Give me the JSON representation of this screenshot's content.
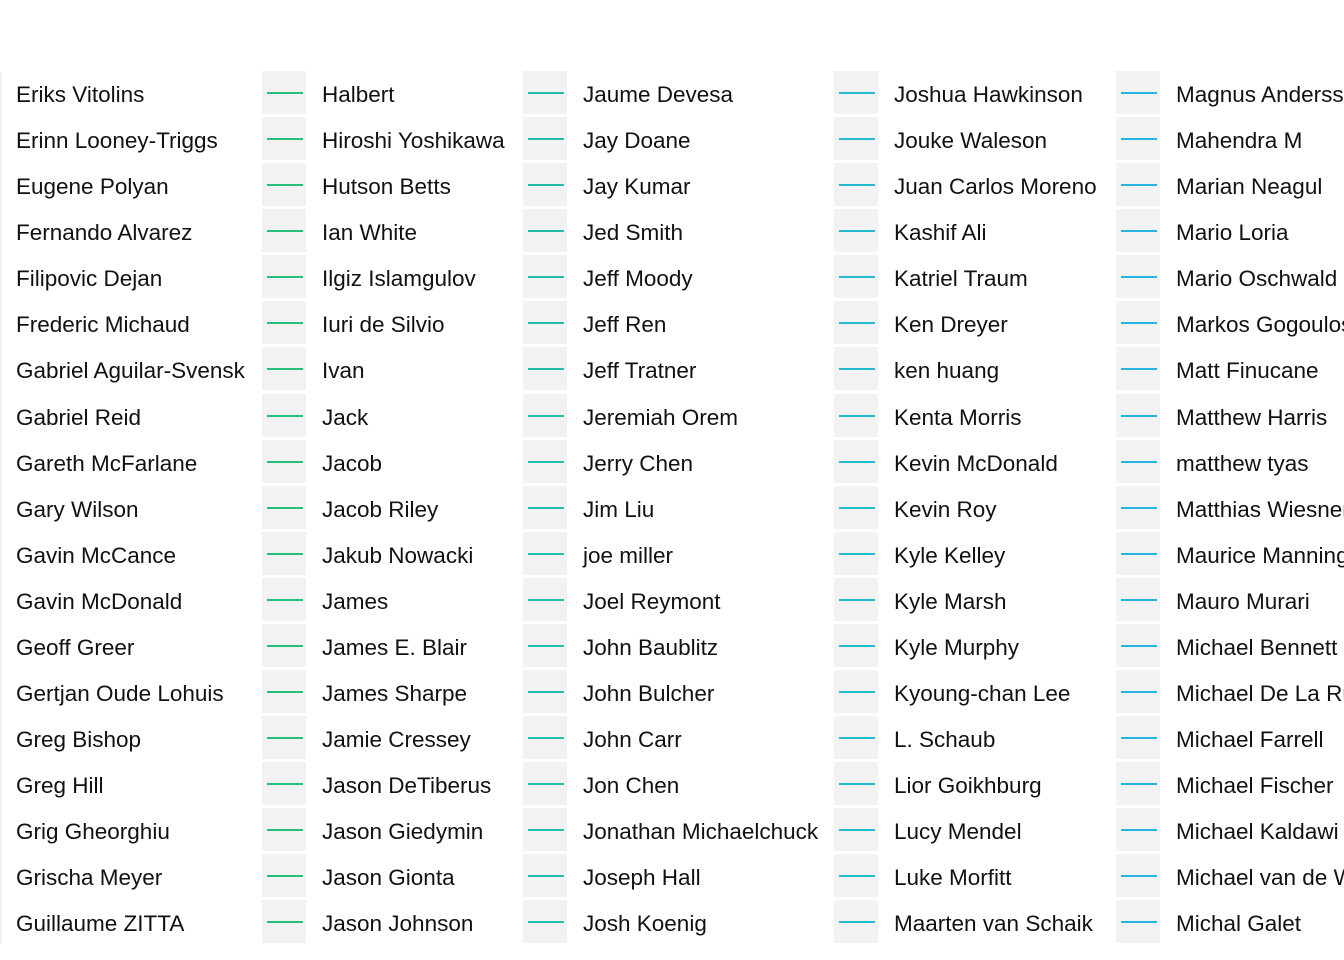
{
  "columns": [
    {
      "names": [
        "Eriks Vitolins",
        "Erinn Looney-Triggs",
        "Eugene Polyan",
        "Fernando Alvarez",
        "Filipovic Dejan",
        "Frederic Michaud",
        "Gabriel Aguilar-Svensk",
        "Gabriel Reid",
        "Gareth McFarlane",
        "Gary Wilson",
        "Gavin McCance",
        "Gavin McDonald",
        "Geoff Greer",
        "Gertjan Oude Lohuis",
        "Greg Bishop",
        "Greg Hill",
        "Grig Gheorghiu",
        "Grischa Meyer",
        "Guillaume ZITTA"
      ]
    },
    {
      "names": [
        "Halbert",
        "Hiroshi Yoshikawa",
        "Hutson Betts",
        "Ian White",
        "Ilgiz Islamgulov",
        "Iuri de Silvio",
        "Ivan",
        "Jack",
        "Jacob",
        "Jacob Riley",
        "Jakub Nowacki",
        "James",
        "James E. Blair",
        "James Sharpe",
        "Jamie Cressey",
        "Jason DeTiberus",
        "Jason Giedymin",
        "Jason Gionta",
        "Jason Johnson"
      ]
    },
    {
      "names": [
        "Jaume Devesa",
        "Jay Doane",
        "Jay Kumar",
        "Jed Smith",
        "Jeff Moody",
        "Jeff Ren",
        "Jeff Tratner",
        "Jeremiah Orem",
        "Jerry Chen",
        "Jim Liu",
        "joe miller",
        "Joel Reymont",
        "John Baublitz",
        "John Bulcher",
        "John Carr",
        "Jon Chen",
        "Jonathan Michaelchuck",
        "Joseph Hall",
        "Josh Koenig"
      ]
    },
    {
      "names": [
        "Joshua Hawkinson",
        "Jouke Waleson",
        "Juan Carlos Moreno",
        "Kashif Ali",
        "Katriel Traum",
        "Ken Dreyer",
        "ken huang",
        "Kenta Morris",
        "Kevin McDonald",
        "Kevin Roy",
        "Kyle Kelley",
        "Kyle Marsh",
        "Kyle Murphy",
        "Kyoung-chan Lee",
        "L. Schaub",
        "Lior Goikhburg",
        "Lucy Mendel",
        "Luke Morfitt",
        "Maarten van Schaik"
      ]
    },
    {
      "names": [
        "Magnus Andersson",
        "Mahendra M",
        "Marian Neagul",
        "Mario Loria",
        "Mario Oschwald",
        "Markos Gogoulos",
        "Matt Finucane",
        "Matthew Harris",
        "matthew tyas",
        "Matthias Wiesner",
        "Maurice Manning",
        "Mauro Murari",
        "Michael Bennett",
        "Michael De La Rue",
        "Michael Farrell",
        "Michael Fischer",
        "Michael Kaldawi",
        "Michael van de Waeter",
        "Michal Galet"
      ]
    }
  ],
  "connectors": [
    {
      "color": "#22c07a"
    },
    {
      "color": "#1fbfa8"
    },
    {
      "color": "#20bccb"
    },
    {
      "color": "#25b3e0"
    }
  ]
}
